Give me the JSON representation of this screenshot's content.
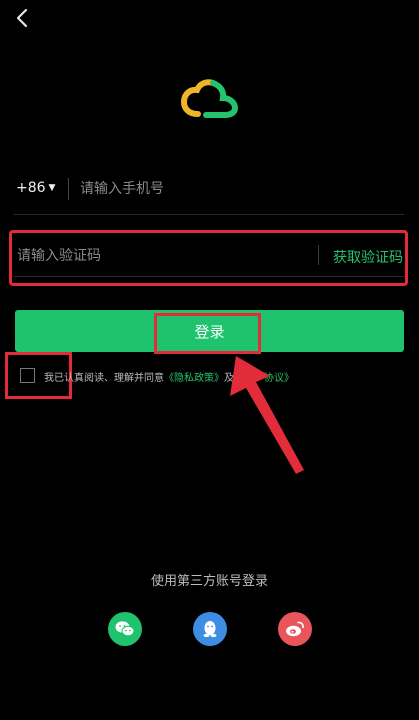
{
  "header": {
    "back_icon": "chevron-left-icon"
  },
  "logo": {
    "icon": "cloud-logo-icon",
    "colors": [
      "#f0b429",
      "#23c46c"
    ]
  },
  "phone": {
    "country_code": "+86",
    "placeholder": "请输入手机号"
  },
  "code": {
    "placeholder": "请输入验证码",
    "get_code_label": "获取验证码"
  },
  "login": {
    "label": "登录"
  },
  "agreement": {
    "text": "我已认真阅读、理解并同意",
    "privacy_link": "《隐私政策》",
    "connector": "及",
    "user_link": "《用户协议》"
  },
  "third_party": {
    "title": "使用第三方账号登录",
    "icons": [
      "wechat-icon",
      "qq-icon",
      "weibo-icon"
    ]
  },
  "colors": {
    "accent": "#1fc36d",
    "highlight": "#e32c3a",
    "background": "#000000"
  }
}
